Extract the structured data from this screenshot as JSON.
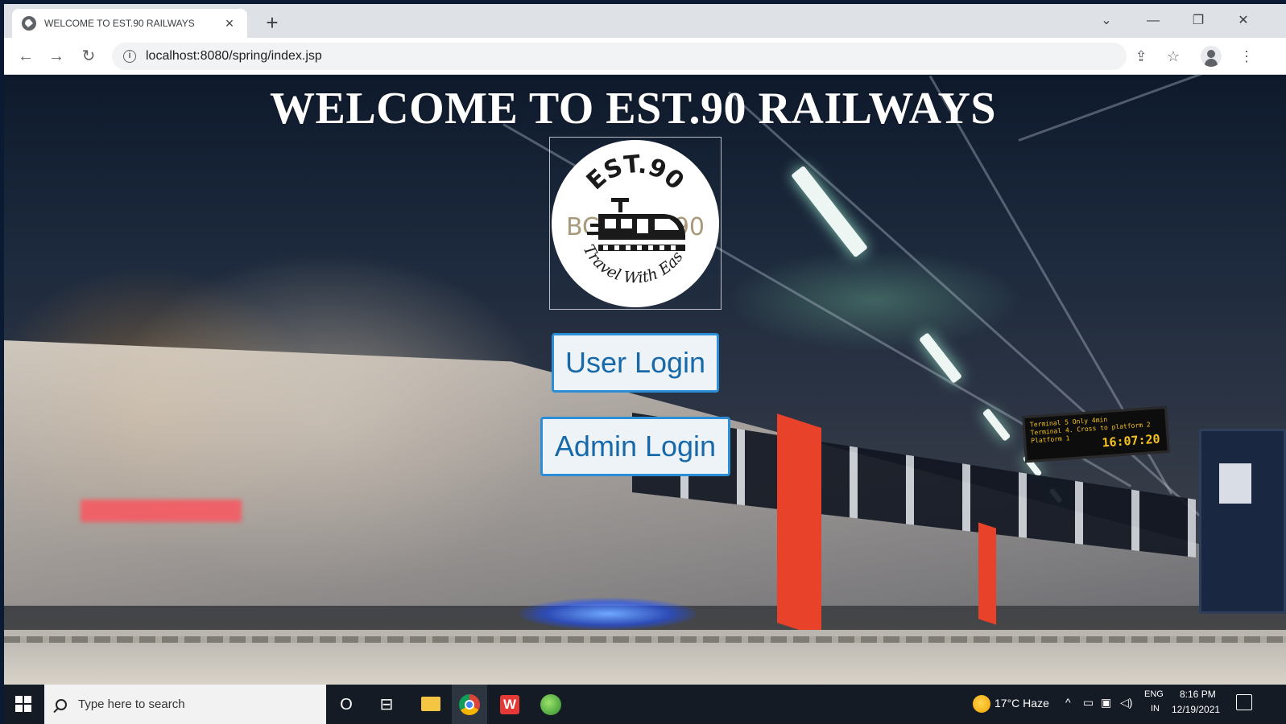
{
  "browser": {
    "tab_title": "WELCOME TO EST.90 RAILWAYS",
    "tab_close": "×",
    "new_tab": "+",
    "url": "localhost:8080/spring/index.jsp",
    "back": "←",
    "forward": "→",
    "reload": "↻",
    "share": "⇪",
    "bookmark": "☆",
    "menu": "⋮",
    "tab_search": "⌄",
    "minimize": "—",
    "restore": "❐",
    "close": "✕"
  },
  "page": {
    "title": "WELCOME TO EST.90 RAILWAYS",
    "logo": {
      "top_text": "EST.90",
      "left_text": "BC",
      "right_text": "90",
      "bottom_text": "Travel With Ease"
    },
    "user_login_label": "User Login",
    "admin_login_label": "Admin Login",
    "sign": {
      "line1": "Terminal 5 Only       4min",
      "line2": "Terminal 4. Cross to platform 2",
      "line3": "Platform 1",
      "time": "16:07:20"
    }
  },
  "taskbar": {
    "search_placeholder": "Type here to search",
    "cortana": "O",
    "task_view": "⊟",
    "weather": "17°C  Haze",
    "tray_chevron": "^",
    "language": "ENG",
    "region": "IN",
    "time": "8:16 PM",
    "date": "12/19/2021"
  },
  "colors": {
    "button_border": "#2b8ed6",
    "button_text": "#1769aa",
    "taskbar": "#151b24"
  }
}
